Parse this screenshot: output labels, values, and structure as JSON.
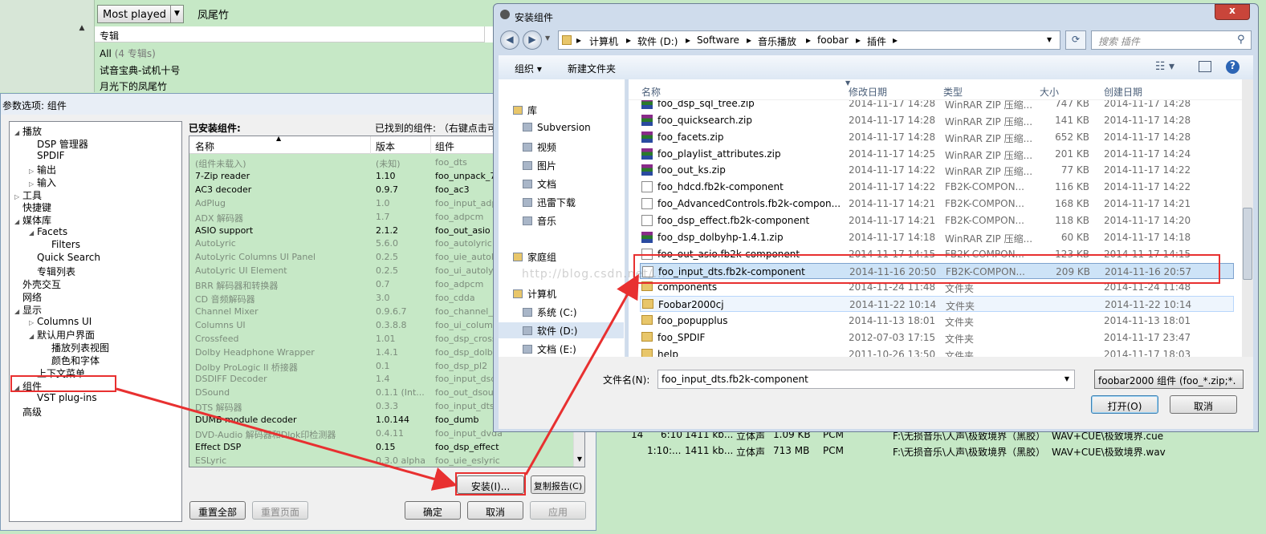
{
  "bg": {
    "view_combo": "Most played",
    "song_title": "凤尾竹",
    "filter_header": "专辑",
    "filter_rows": [
      {
        "text": "All",
        "note": "(4 专辑s)"
      },
      {
        "text": "试音宝典-试机十号"
      },
      {
        "text": "月光下的凤尾竹"
      }
    ],
    "playlist_rows": [
      {
        "num": "14",
        "len": "6:10",
        "bitrate": "1411 kb...",
        "ch": "立体声",
        "size": "1.09 KB",
        "codec": "PCM",
        "path": "F:\\无损音乐\\人声\\极致境界（黑胶）",
        "file": "WAV+CUE\\极致境界.cue"
      },
      {
        "num": "",
        "len": "1:10:...",
        "bitrate": "1411 kb...",
        "ch": "立体声",
        "size": "713 MB",
        "codec": "PCM",
        "path": "F:\\无损音乐\\人声\\极致境界（黑胶）",
        "file": "WAV+CUE\\极致境界.wav"
      }
    ]
  },
  "prefs": {
    "title": "参数选项: 组件",
    "tree": [
      {
        "label": "播放",
        "toggle": "◢",
        "indent": 0
      },
      {
        "label": "DSP 管理器",
        "indent": 1
      },
      {
        "label": "SPDIF",
        "indent": 1
      },
      {
        "label": "输出",
        "toggle": "▷",
        "indent": 1
      },
      {
        "label": "输入",
        "toggle": "▷",
        "indent": 1
      },
      {
        "label": "工具",
        "toggle": "▷",
        "indent": 0
      },
      {
        "label": "快捷键",
        "indent": 0
      },
      {
        "label": "媒体库",
        "toggle": "◢",
        "indent": 0
      },
      {
        "label": "Facets",
        "toggle": "◢",
        "indent": 1
      },
      {
        "label": "Filters",
        "indent": 2
      },
      {
        "label": "Quick Search",
        "indent": 1
      },
      {
        "label": "专辑列表",
        "indent": 1
      },
      {
        "label": "外壳交互",
        "indent": 0
      },
      {
        "label": "网络",
        "indent": 0
      },
      {
        "label": "显示",
        "toggle": "◢",
        "indent": 0
      },
      {
        "label": "Columns UI",
        "toggle": "▷",
        "indent": 1
      },
      {
        "label": "默认用户界面",
        "toggle": "◢",
        "indent": 1
      },
      {
        "label": "播放列表视图",
        "indent": 2
      },
      {
        "label": "颜色和字体",
        "indent": 2
      },
      {
        "label": "上下文菜单",
        "indent": 1
      },
      {
        "label": "组件",
        "toggle": "◢",
        "indent": 0
      },
      {
        "label": "VST plug-ins",
        "indent": 1
      },
      {
        "label": "高级",
        "indent": 0
      }
    ],
    "installed_label": "已安装组件:",
    "found_label": "已找到的组件: （右键点击可",
    "columns": {
      "name": "名称",
      "version": "版本",
      "component": "组件"
    },
    "components": [
      {
        "name": "(组件未载入)",
        "version": "(未知)",
        "file": "foo_dts",
        "loaded": false
      },
      {
        "name": "7-Zip reader",
        "version": "1.10",
        "file": "foo_unpack_7z",
        "loaded": true
      },
      {
        "name": "AC3 decoder",
        "version": "0.9.7",
        "file": "foo_ac3",
        "loaded": true
      },
      {
        "name": "AdPlug",
        "version": "1.0",
        "file": "foo_input_adplug",
        "loaded": false
      },
      {
        "name": "ADX 解码器",
        "version": "1.7",
        "file": "foo_adpcm",
        "loaded": false
      },
      {
        "name": "ASIO support",
        "version": "2.1.2",
        "file": "foo_out_asio",
        "loaded": true
      },
      {
        "name": "AutoLyric",
        "version": "5.6.0",
        "file": "foo_autolyric",
        "loaded": false
      },
      {
        "name": "AutoLyric Columns UI Panel",
        "version": "0.2.5",
        "file": "foo_uie_autolyric",
        "loaded": false
      },
      {
        "name": "AutoLyric UI Element",
        "version": "0.2.5",
        "file": "foo_ui_autolyric",
        "loaded": false
      },
      {
        "name": "BRR 解码器和转换器",
        "version": "0.7",
        "file": "foo_adpcm",
        "loaded": false
      },
      {
        "name": "CD 音频解码器",
        "version": "3.0",
        "file": "foo_cdda",
        "loaded": false
      },
      {
        "name": "Channel Mixer",
        "version": "0.9.6.7",
        "file": "foo_channel_mixer",
        "loaded": false
      },
      {
        "name": "Columns UI",
        "version": "0.3.8.8",
        "file": "foo_ui_columns",
        "loaded": false
      },
      {
        "name": "Crossfeed",
        "version": "1.01",
        "file": "foo_dsp_crossfeed",
        "loaded": false
      },
      {
        "name": "Dolby Headphone Wrapper",
        "version": "1.4.1",
        "file": "foo_dsp_dolbyhp",
        "loaded": false
      },
      {
        "name": "Dolby ProLogic II 桥接器",
        "version": "0.1",
        "file": "foo_dsp_pl2",
        "loaded": false
      },
      {
        "name": "DSDIFF Decoder",
        "version": "1.4",
        "file": "foo_input_dsdiff",
        "loaded": false
      },
      {
        "name": "DSound",
        "version": "0.1.1 (Int...",
        "file": "foo_out_dsound",
        "loaded": false
      },
      {
        "name": "DTS 解码器",
        "version": "0.3.3",
        "file": "foo_input_dts",
        "loaded": false
      },
      {
        "name": "DUMB module decoder",
        "version": "1.0.144",
        "file": "foo_dumb",
        "loaded": true
      },
      {
        "name": "DVD-Audio 解码器和Dlok印检测器",
        "version": "0.4.11",
        "file": "foo_input_dvda",
        "loaded": false
      },
      {
        "name": "Effect DSP",
        "version": "0.15",
        "file": "foo_dsp_effect",
        "loaded": true
      },
      {
        "name": "ESLyric",
        "version": "0.3.0 alpha",
        "file": "foo_uie_eslyric",
        "loaded": false
      }
    ],
    "buttons": {
      "install": "安装(I)...",
      "copy_report": "复制报告(C)",
      "reset_all": "重置全部",
      "reset_page": "重置页面",
      "ok": "确定",
      "cancel": "取消",
      "apply": "应用"
    }
  },
  "filedialog": {
    "title": "安装组件",
    "close": "x",
    "breadcrumb": [
      "计算机",
      "软件 (D:)",
      "Software",
      "音乐播放",
      "foobar",
      "插件"
    ],
    "search_placeholder": "搜索 插件",
    "toolbar": {
      "organize": "组织 ▾",
      "new_folder": "新建文件夹"
    },
    "nav": [
      {
        "label": "库",
        "group": true
      },
      {
        "label": "Subversion"
      },
      {
        "label": "视频"
      },
      {
        "label": "图片"
      },
      {
        "label": "文档"
      },
      {
        "label": "迅雷下载"
      },
      {
        "label": "音乐"
      },
      {
        "label": "家庭组",
        "group": true
      },
      {
        "label": "计算机",
        "group": true
      },
      {
        "label": "系统 (C:)"
      },
      {
        "label": "软件 (D:)",
        "selected": true
      },
      {
        "label": "文档 (E:)"
      }
    ],
    "columns": {
      "name": "名称",
      "modified": "修改日期",
      "type": "类型",
      "size": "大小",
      "created": "创建日期"
    },
    "files": [
      {
        "name": "foo_dsp_sql_tree.zip",
        "modified": "2014-11-17 14:28",
        "type": "WinRAR ZIP 压缩...",
        "size": "747 KB",
        "created": "2014-11-17 14:28",
        "icon": "zip",
        "partial": true
      },
      {
        "name": "foo_quicksearch.zip",
        "modified": "2014-11-17 14:28",
        "type": "WinRAR ZIP 压缩...",
        "size": "141 KB",
        "created": "2014-11-17 14:28",
        "icon": "zip"
      },
      {
        "name": "foo_facets.zip",
        "modified": "2014-11-17 14:28",
        "type": "WinRAR ZIP 压缩...",
        "size": "652 KB",
        "created": "2014-11-17 14:28",
        "icon": "zip"
      },
      {
        "name": "foo_playlist_attributes.zip",
        "modified": "2014-11-17 14:25",
        "type": "WinRAR ZIP 压缩...",
        "size": "201 KB",
        "created": "2014-11-17 14:24",
        "icon": "zip"
      },
      {
        "name": "foo_out_ks.zip",
        "modified": "2014-11-17 14:22",
        "type": "WinRAR ZIP 压缩...",
        "size": "77 KB",
        "created": "2014-11-17 14:22",
        "icon": "zip"
      },
      {
        "name": "foo_hdcd.fb2k-component",
        "modified": "2014-11-17 14:22",
        "type": "FB2K-COMPON...",
        "size": "116 KB",
        "created": "2014-11-17 14:22",
        "icon": "file"
      },
      {
        "name": "foo_AdvancedControls.fb2k-compon...",
        "modified": "2014-11-17 14:21",
        "type": "FB2K-COMPON...",
        "size": "168 KB",
        "created": "2014-11-17 14:21",
        "icon": "file"
      },
      {
        "name": "foo_dsp_effect.fb2k-component",
        "modified": "2014-11-17 14:21",
        "type": "FB2K-COMPON...",
        "size": "118 KB",
        "created": "2014-11-17 14:20",
        "icon": "file"
      },
      {
        "name": "foo_dsp_dolbyhp-1.4.1.zip",
        "modified": "2014-11-17 14:18",
        "type": "WinRAR ZIP 压缩...",
        "size": "60 KB",
        "created": "2014-11-17 14:18",
        "icon": "zip"
      },
      {
        "name": "foo_out_asio.fb2k-component",
        "modified": "2014-11-17 14:15",
        "type": "FB2K-COMPON...",
        "size": "123 KB",
        "created": "2014-11-17 14:15",
        "icon": "file"
      },
      {
        "name": "foo_input_dts.fb2k-component",
        "modified": "2014-11-16 20:50",
        "type": "FB2K-COMPON...",
        "size": "209 KB",
        "created": "2014-11-16 20:57",
        "icon": "file",
        "selected": true
      },
      {
        "name": "components",
        "modified": "2014-11-24 11:48",
        "type": "文件夹",
        "size": "",
        "created": "2014-11-24 11:48",
        "icon": "folder"
      },
      {
        "name": "Foobar2000cj",
        "modified": "2014-11-22 10:14",
        "type": "文件夹",
        "size": "",
        "created": "2014-11-22 10:14",
        "icon": "folder",
        "hover": true
      },
      {
        "name": "foo_popupplus",
        "modified": "2014-11-13 18:01",
        "type": "文件夹",
        "size": "",
        "created": "2014-11-13 18:01",
        "icon": "folder"
      },
      {
        "name": "foo_SPDIF",
        "modified": "2012-07-03 17:15",
        "type": "文件夹",
        "size": "",
        "created": "2014-11-17 23:47",
        "icon": "folder"
      },
      {
        "name": "help",
        "modified": "2011-10-26 13:50",
        "type": "文件夹",
        "size": "",
        "created": "2014-11-17 18:03",
        "icon": "folder"
      }
    ],
    "filename_label": "文件名(N):",
    "filename_value": "foo_input_dts.fb2k-component",
    "filetype_value": "foobar2000 组件 (foo_*.zip;*.",
    "open_button": "打开(O)",
    "cancel_button": "取消"
  },
  "watermark": "http://blog.csdn.net/..."
}
